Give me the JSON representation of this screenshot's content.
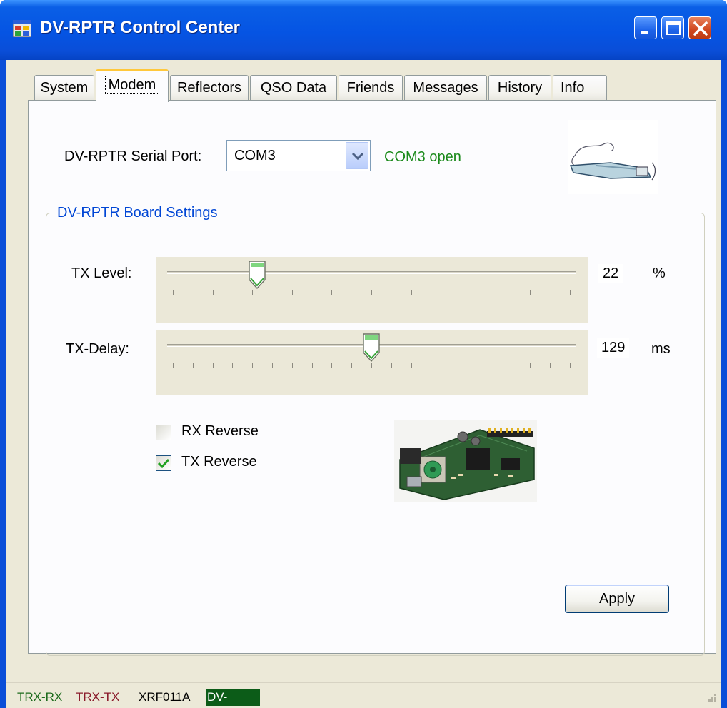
{
  "window": {
    "title": "DV-RPTR Control Center",
    "controls": [
      "minimize",
      "maximize",
      "close"
    ]
  },
  "tabs": [
    {
      "label": "System",
      "active": false
    },
    {
      "label": "Modem",
      "active": true
    },
    {
      "label": "Reflectors",
      "active": false
    },
    {
      "label": "QSO Data",
      "active": false
    },
    {
      "label": "Friends",
      "active": false
    },
    {
      "label": "Messages",
      "active": false
    },
    {
      "label": "History",
      "active": false
    },
    {
      "label": "Info",
      "active": false
    }
  ],
  "modem": {
    "serial_port_label": "DV-RPTR Serial Port:",
    "serial_port_value": "COM3",
    "serial_status": "COM3 open",
    "board_settings_title": "DV-RPTR Board Settings",
    "tx_level": {
      "label": "TX Level:",
      "value": "22",
      "unit": "%",
      "fraction": 0.22,
      "ticks": 11
    },
    "tx_delay": {
      "label": "TX-Delay:",
      "value": "129",
      "unit": "ms",
      "fraction": 0.5,
      "ticks": 21
    },
    "rx_reverse": {
      "label": "RX Reverse",
      "checked": false
    },
    "tx_reverse": {
      "label": "TX Reverse",
      "checked": true
    },
    "apply_label": "Apply"
  },
  "statusbar": {
    "trx_rx": "TRX-RX",
    "trx_tx": "TRX-TX",
    "reflector": "XRF011A",
    "device": "DV-RPTR"
  },
  "colors": {
    "titlebar": "#0a4ed8",
    "status_ok": "#1b8a1b",
    "group_title": "#0046d5",
    "trx_rx": "#1b6a1b",
    "trx_tx": "#8a1a2a",
    "device_bg": "#0c5c18"
  }
}
